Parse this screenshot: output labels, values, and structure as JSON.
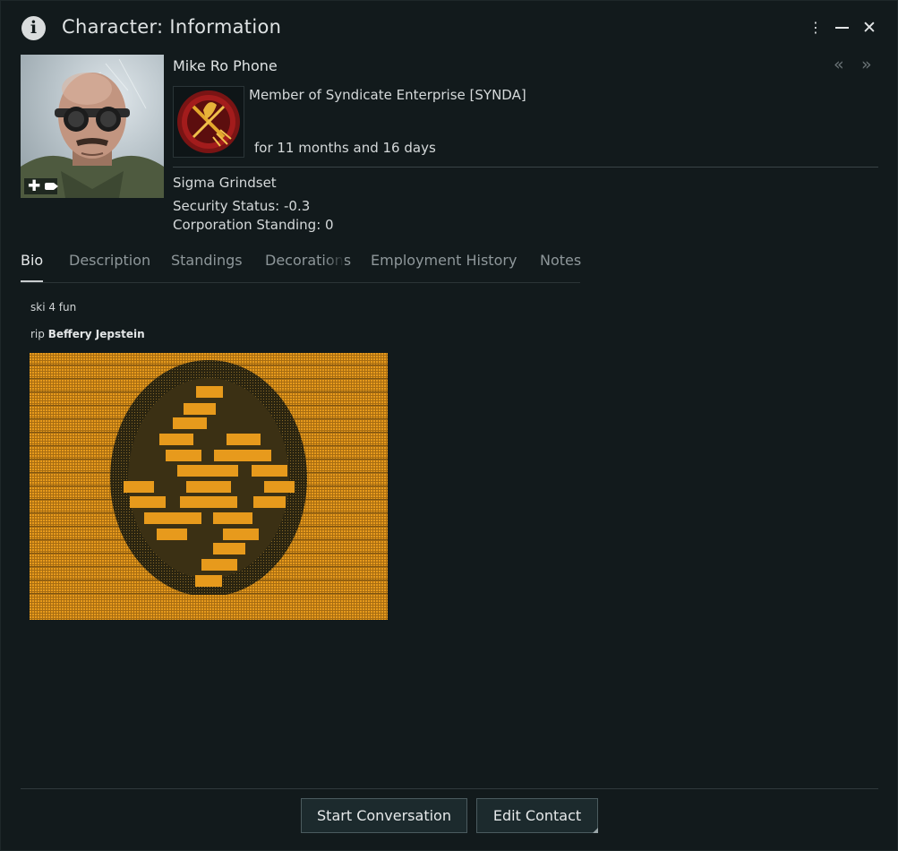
{
  "window": {
    "title": "Character: Information",
    "menu_glyph": "⋮",
    "close_glyph": "✕",
    "nav_back_glyph": "«",
    "nav_forward_glyph": "»"
  },
  "character": {
    "name": "Mike Ro Phone",
    "corporation_line": "Member of Syndicate Enterprise [SYNDA]",
    "membership_duration": "for 11 months and 16 days",
    "alliance": "Sigma Grindset",
    "security_status": "Security Status: -0.3",
    "corporation_standing": "Corporation Standing: 0",
    "portrait_tag_plus": "✚"
  },
  "tabs": [
    {
      "label": "Bio",
      "active": true
    },
    {
      "label": "Description",
      "active": false
    },
    {
      "label": "Standings",
      "active": false
    },
    {
      "label": "Decorations",
      "active": false
    },
    {
      "label": "Employment History",
      "active": false
    },
    {
      "label": "Notes",
      "active": false
    }
  ],
  "bio": {
    "line1": "ski 4 fun",
    "line2_prefix": "rip",
    "line2_name": "Beffery Jepstein"
  },
  "buttons": {
    "start_conversation": "Start Conversation",
    "edit_contact": "Edit Contact"
  },
  "colors": {
    "background": "#121a1c",
    "ascii_orange": "#e79a1c",
    "ascii_dark": "#4a3a18",
    "button_bg": "#1c2a2d"
  },
  "icons": [
    "info-icon",
    "more-menu-icon",
    "minimize-icon",
    "close-icon",
    "nav-back-icon",
    "nav-forward-icon",
    "plus-icon",
    "tag-icon",
    "corp-logo"
  ]
}
